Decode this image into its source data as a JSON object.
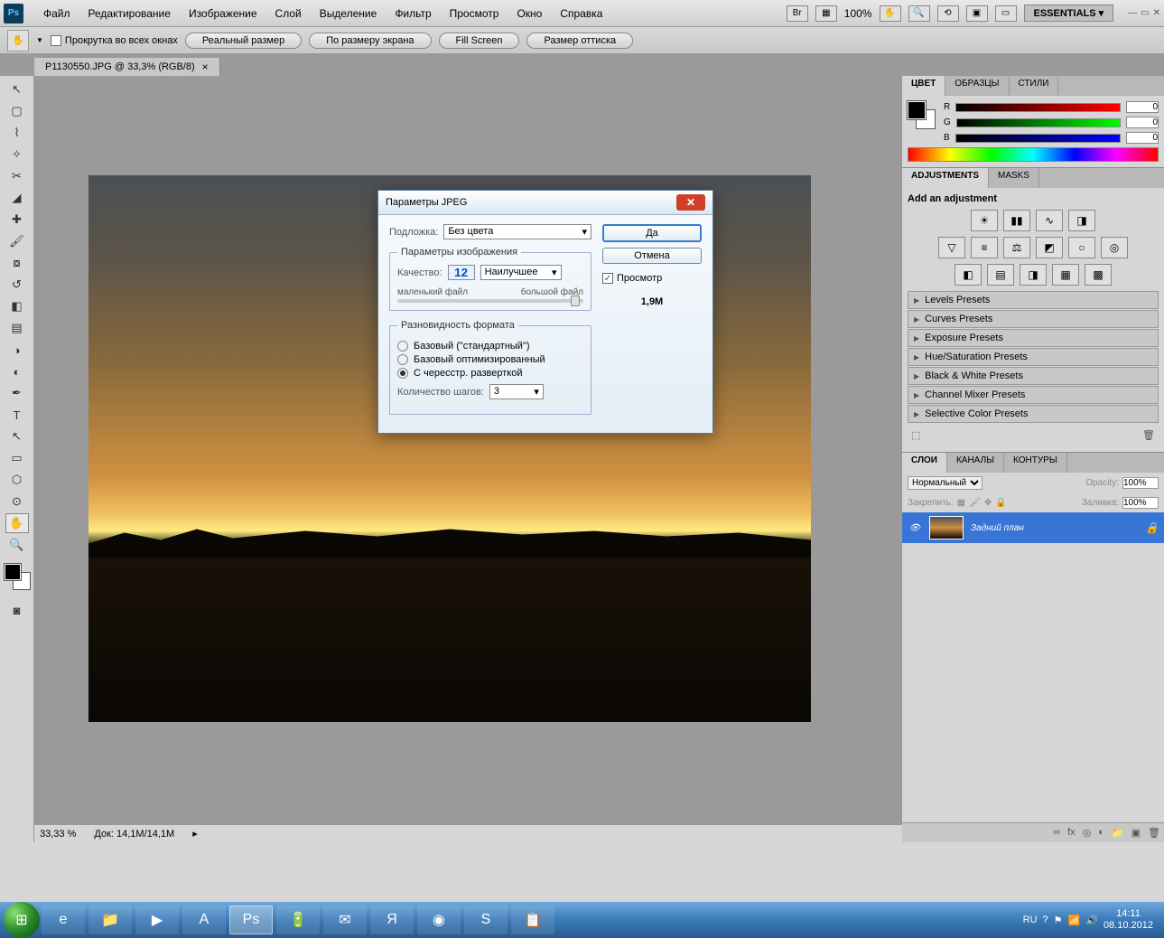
{
  "menubar": {
    "items": [
      "Файл",
      "Редактирование",
      "Изображение",
      "Слой",
      "Выделение",
      "Фильтр",
      "Просмотр",
      "Окно",
      "Справка"
    ],
    "zoom": "100%",
    "workspace": "ESSENTIALS ▾"
  },
  "optbar": {
    "scroll_all": "Прокрутка во всех окнах",
    "actual": "Реальный размер",
    "fit_screen": "По размеру экрана",
    "fill_screen": "Fill Screen",
    "print_size": "Размер оттиска"
  },
  "doc_tab": {
    "title": "P1130550.JPG @ 33,3% (RGB/8)"
  },
  "panels": {
    "color": {
      "tabs": [
        "ЦВЕТ",
        "ОБРАЗЦЫ",
        "СТИЛИ"
      ],
      "r": "0",
      "g": "0",
      "b": "0"
    },
    "adjustments": {
      "tabs": [
        "ADJUSTMENTS",
        "MASKS"
      ],
      "heading": "Add an adjustment",
      "presets": [
        "Levels Presets",
        "Curves Presets",
        "Exposure Presets",
        "Hue/Saturation Presets",
        "Black & White Presets",
        "Channel Mixer Presets",
        "Selective Color Presets"
      ]
    },
    "layers": {
      "tabs": [
        "СЛОИ",
        "КАНАЛЫ",
        "КОНТУРЫ"
      ],
      "mode": "Нормальный",
      "opacity_label": "Opacity:",
      "opacity": "100%",
      "lock_label": "Закрепить:",
      "fill_label": "Заливка:",
      "fill": "100%",
      "layer_name": "Задний план"
    }
  },
  "status": {
    "zoom": "33,33 %",
    "doc": "Док: 14,1M/14,1M"
  },
  "dialog": {
    "title": "Параметры JPEG",
    "matte_label": "Подложка:",
    "matte_value": "Без цвета",
    "image_opts_legend": "Параметры изображения",
    "quality_label": "Качество:",
    "quality_value": "12",
    "quality_preset": "Наилучшее",
    "small_file": "маленький файл",
    "large_file": "большой файл",
    "format_legend": "Разновидность формата",
    "fmt_baseline": "Базовый (\"стандартный\")",
    "fmt_optimized": "Базовый оптимизированный",
    "fmt_progressive": "С чересстр. разверткой",
    "scans_label": "Количество шагов:",
    "scans": "3",
    "ok": "Да",
    "cancel": "Отмена",
    "preview": "Просмотр",
    "filesize": "1,9M"
  },
  "taskbar": {
    "lang": "RU",
    "time": "14:11",
    "date": "08.10.2012"
  }
}
